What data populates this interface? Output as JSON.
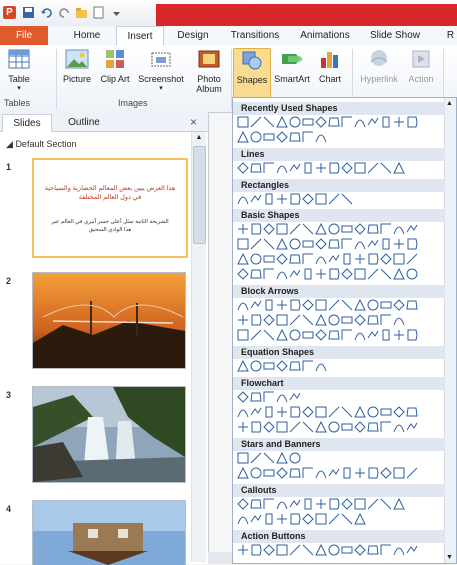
{
  "title_bar": {
    "app_badge": "P",
    "quick_access": [
      "save-icon",
      "undo-icon",
      "redo-icon",
      "open-icon",
      "new-icon"
    ]
  },
  "tabs": [
    "File",
    "Home",
    "Insert",
    "Design",
    "Transitions",
    "Animations",
    "Slide Show",
    "R"
  ],
  "ribbon": {
    "groups": [
      "Tables",
      "Images"
    ],
    "buttons": {
      "table": "Table",
      "picture": "Picture",
      "clip_art": "Clip Art",
      "screenshot": "Screenshot",
      "photo_album": "Photo Album",
      "shapes": "Shapes",
      "smartart": "SmartArt",
      "chart": "Chart",
      "hyperlink": "Hyperlink",
      "action": "Action"
    }
  },
  "left_pane": {
    "tabs": [
      "Slides",
      "Outline"
    ],
    "close": "×",
    "section": "Default Section",
    "slides": [
      {
        "num": "1",
        "title": "هذا العرض يبين بعض المعالم الحضارية والسياحية في دول العالم المختلفة",
        "body": "الشريحة الثانية تمثل أعلى جسر أثيري في العالم عبر هذا الوادي السحيق"
      },
      {
        "num": "2"
      },
      {
        "num": "3"
      },
      {
        "num": "4"
      }
    ]
  },
  "shapes_gallery": {
    "sections": [
      "Recently Used Shapes",
      "Lines",
      "Rectangles",
      "Basic Shapes",
      "Block Arrows",
      "Equation Shapes",
      "Flowchart",
      "Stars and Banners",
      "Callouts",
      "Action Buttons"
    ]
  },
  "colors": {
    "accent_red": "#d9262b",
    "file_tab": "#e05b2b",
    "selection": "#f5c15d",
    "gallery_header": "#dfe6ef"
  }
}
